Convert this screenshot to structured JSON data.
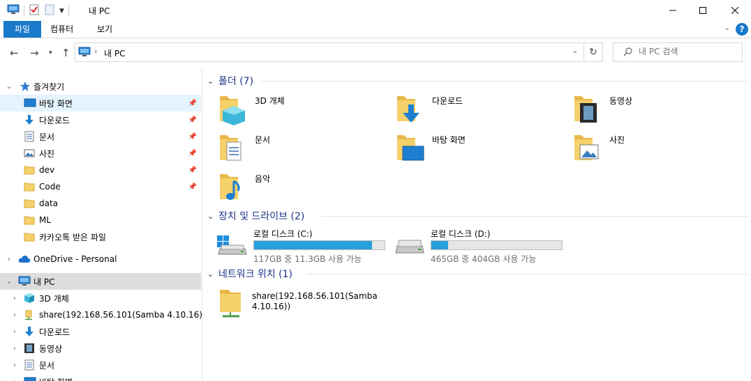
{
  "window": {
    "title": "내 PC"
  },
  "ribbon": {
    "tabs": [
      "파일",
      "컴퓨터",
      "보기"
    ],
    "help": "?"
  },
  "address": {
    "path": "내 PC"
  },
  "search": {
    "placeholder": "내 PC 검색"
  },
  "sidebar": {
    "quick_access": "즐겨찾기",
    "quick_items": [
      {
        "label": "바탕 화면",
        "icon": "desktop-icon",
        "pinned": true
      },
      {
        "label": "다운로드",
        "icon": "download-icon",
        "pinned": true
      },
      {
        "label": "문서",
        "icon": "document-icon",
        "pinned": true
      },
      {
        "label": "사진",
        "icon": "pictures-icon",
        "pinned": true
      },
      {
        "label": "dev",
        "icon": "folder-icon",
        "pinned": true
      },
      {
        "label": "Code",
        "icon": "folder-icon",
        "pinned": true
      },
      {
        "label": "data",
        "icon": "folder-icon",
        "pinned": false
      },
      {
        "label": "ML",
        "icon": "folder-icon",
        "pinned": false
      },
      {
        "label": "카카오톡 받은 파일",
        "icon": "folder-icon",
        "pinned": false
      }
    ],
    "onedrive": "OneDrive - Personal",
    "thispc": "내 PC",
    "thispc_items": [
      {
        "label": "3D 개체",
        "icon": "3d-objects-icon"
      },
      {
        "label": "share(192.168.56.101(Samba 4.10.16))",
        "icon": "network-share-icon"
      },
      {
        "label": "다운로드",
        "icon": "download-icon"
      },
      {
        "label": "동영상",
        "icon": "videos-icon"
      },
      {
        "label": "문서",
        "icon": "document-icon"
      },
      {
        "label": "바탕 화면",
        "icon": "desktop-icon"
      }
    ]
  },
  "content": {
    "folders_header": "폴더 (7)",
    "folders": [
      {
        "label": "3D 개체",
        "icon": "3d-objects-icon"
      },
      {
        "label": "다운로드",
        "icon": "download-icon"
      },
      {
        "label": "동영상",
        "icon": "videos-icon"
      },
      {
        "label": "문서",
        "icon": "document-icon"
      },
      {
        "label": "바탕 화면",
        "icon": "desktop-icon"
      },
      {
        "label": "사진",
        "icon": "pictures-icon"
      },
      {
        "label": "음악",
        "icon": "music-icon"
      }
    ],
    "drives_header": "장치 및 드라이브 (2)",
    "drives": [
      {
        "name": "로컬 디스크 (C:)",
        "free": "117GB 중 11.3GB 사용 가능",
        "used_fraction": 0.903
      },
      {
        "name": "로컬 디스크 (D:)",
        "free": "465GB 중 404GB 사용 가능",
        "used_fraction": 0.131
      }
    ],
    "network_header": "네트워크 위치 (1)",
    "network": [
      {
        "label_line1": "share(192.168.56.101(Samba",
        "label_line2": "4.10.16))"
      }
    ]
  },
  "colors": {
    "accent": "#1979ca",
    "header_text": "#1e3287",
    "drive_fill": "#26a0da",
    "folder": "#f5d06b"
  }
}
